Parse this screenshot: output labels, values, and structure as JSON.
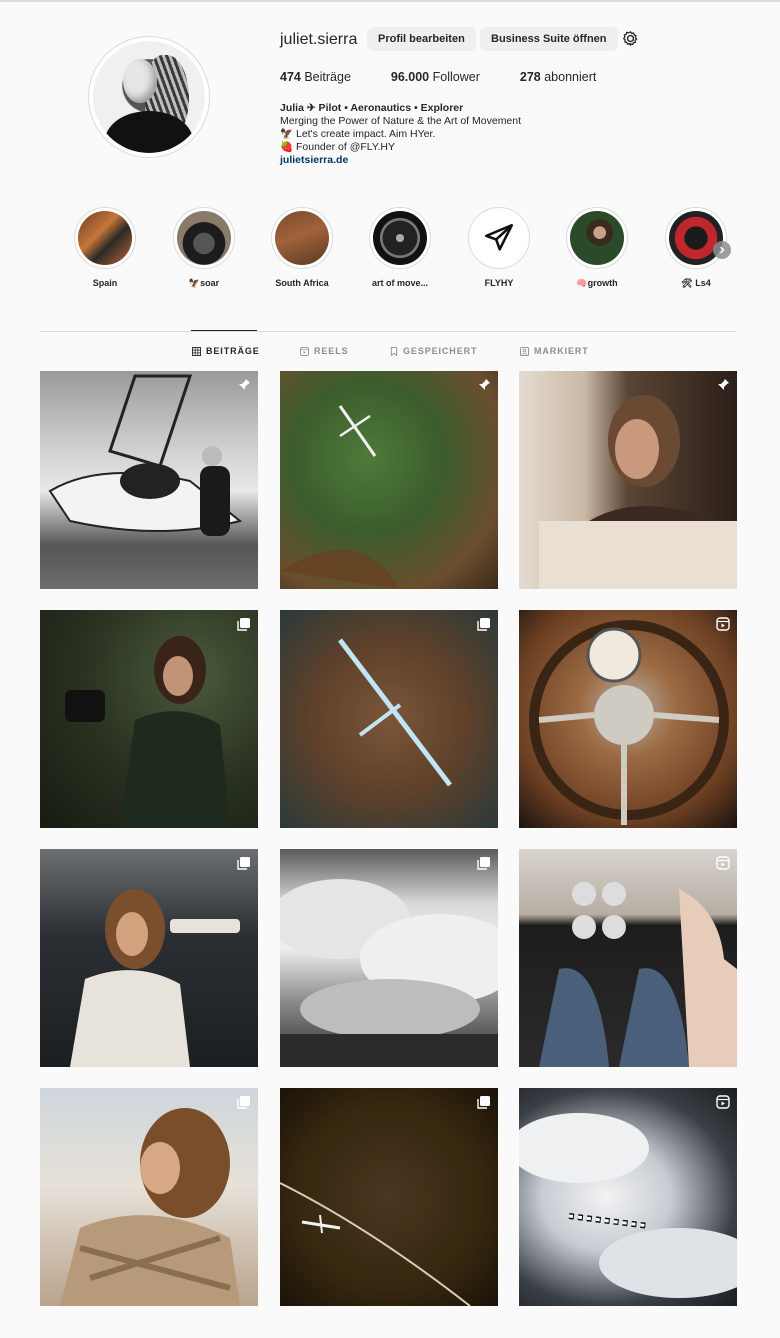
{
  "profile": {
    "username": "juliet.sierra",
    "edit_button": "Profil bearbeiten",
    "suite_button": "Business Suite öffnen",
    "stats": {
      "posts_count": "474",
      "posts_label": "Beiträge",
      "followers_count": "96.000",
      "followers_label": "Follower",
      "following_count": "278",
      "following_label": "abonniert"
    },
    "bio": {
      "name": "Julia ✈ Pilot • Aeronautics • Explorer",
      "line1": "Merging the Power of Nature & the Art of Movement",
      "line2": "🦅 Let's create impact. Aim HYer.",
      "line3": "🍓 Founder of @FLY.HY",
      "website": "julietsierra.de"
    }
  },
  "highlights": [
    {
      "label": "Spain"
    },
    {
      "label": "🦅soar"
    },
    {
      "label": "South Africa"
    },
    {
      "label": "art of move..."
    },
    {
      "label": "FLYHY"
    },
    {
      "label": "🧠growth"
    },
    {
      "label": "🛠 Ls4"
    }
  ],
  "tabs": [
    {
      "label": "BEITRÄGE",
      "icon": "grid-icon",
      "active": true
    },
    {
      "label": "REELS",
      "icon": "reels-icon",
      "active": false
    },
    {
      "label": "GESPEICHERT",
      "icon": "bookmark-icon",
      "active": false
    },
    {
      "label": "MARKIERT",
      "icon": "tagged-icon",
      "active": false
    }
  ],
  "posts": [
    {
      "badge": "pin-icon",
      "subject": "glider and pilot, black and white"
    },
    {
      "badge": "pin-icon",
      "subject": "glider over green landscape"
    },
    {
      "badge": "pin-icon",
      "subject": "woman in vintage car"
    },
    {
      "badge": "carousel-icon",
      "subject": "woman with camera"
    },
    {
      "badge": "carousel-icon",
      "subject": "glider over brown terrain"
    },
    {
      "badge": "reel-icon",
      "subject": "vintage steering wheel"
    },
    {
      "badge": "carousel-icon",
      "subject": "woman with camera in hangar"
    },
    {
      "badge": "carousel-icon",
      "subject": "clouds black and white"
    },
    {
      "badge": "reel-icon",
      "subject": "glider cockpit"
    },
    {
      "badge": "carousel-icon",
      "subject": "woman in patterned jacket"
    },
    {
      "badge": "carousel-icon",
      "subject": "glider over dark terrain"
    },
    {
      "badge": "reel-icon",
      "subject": "zebra-striped glider in clouds"
    }
  ]
}
